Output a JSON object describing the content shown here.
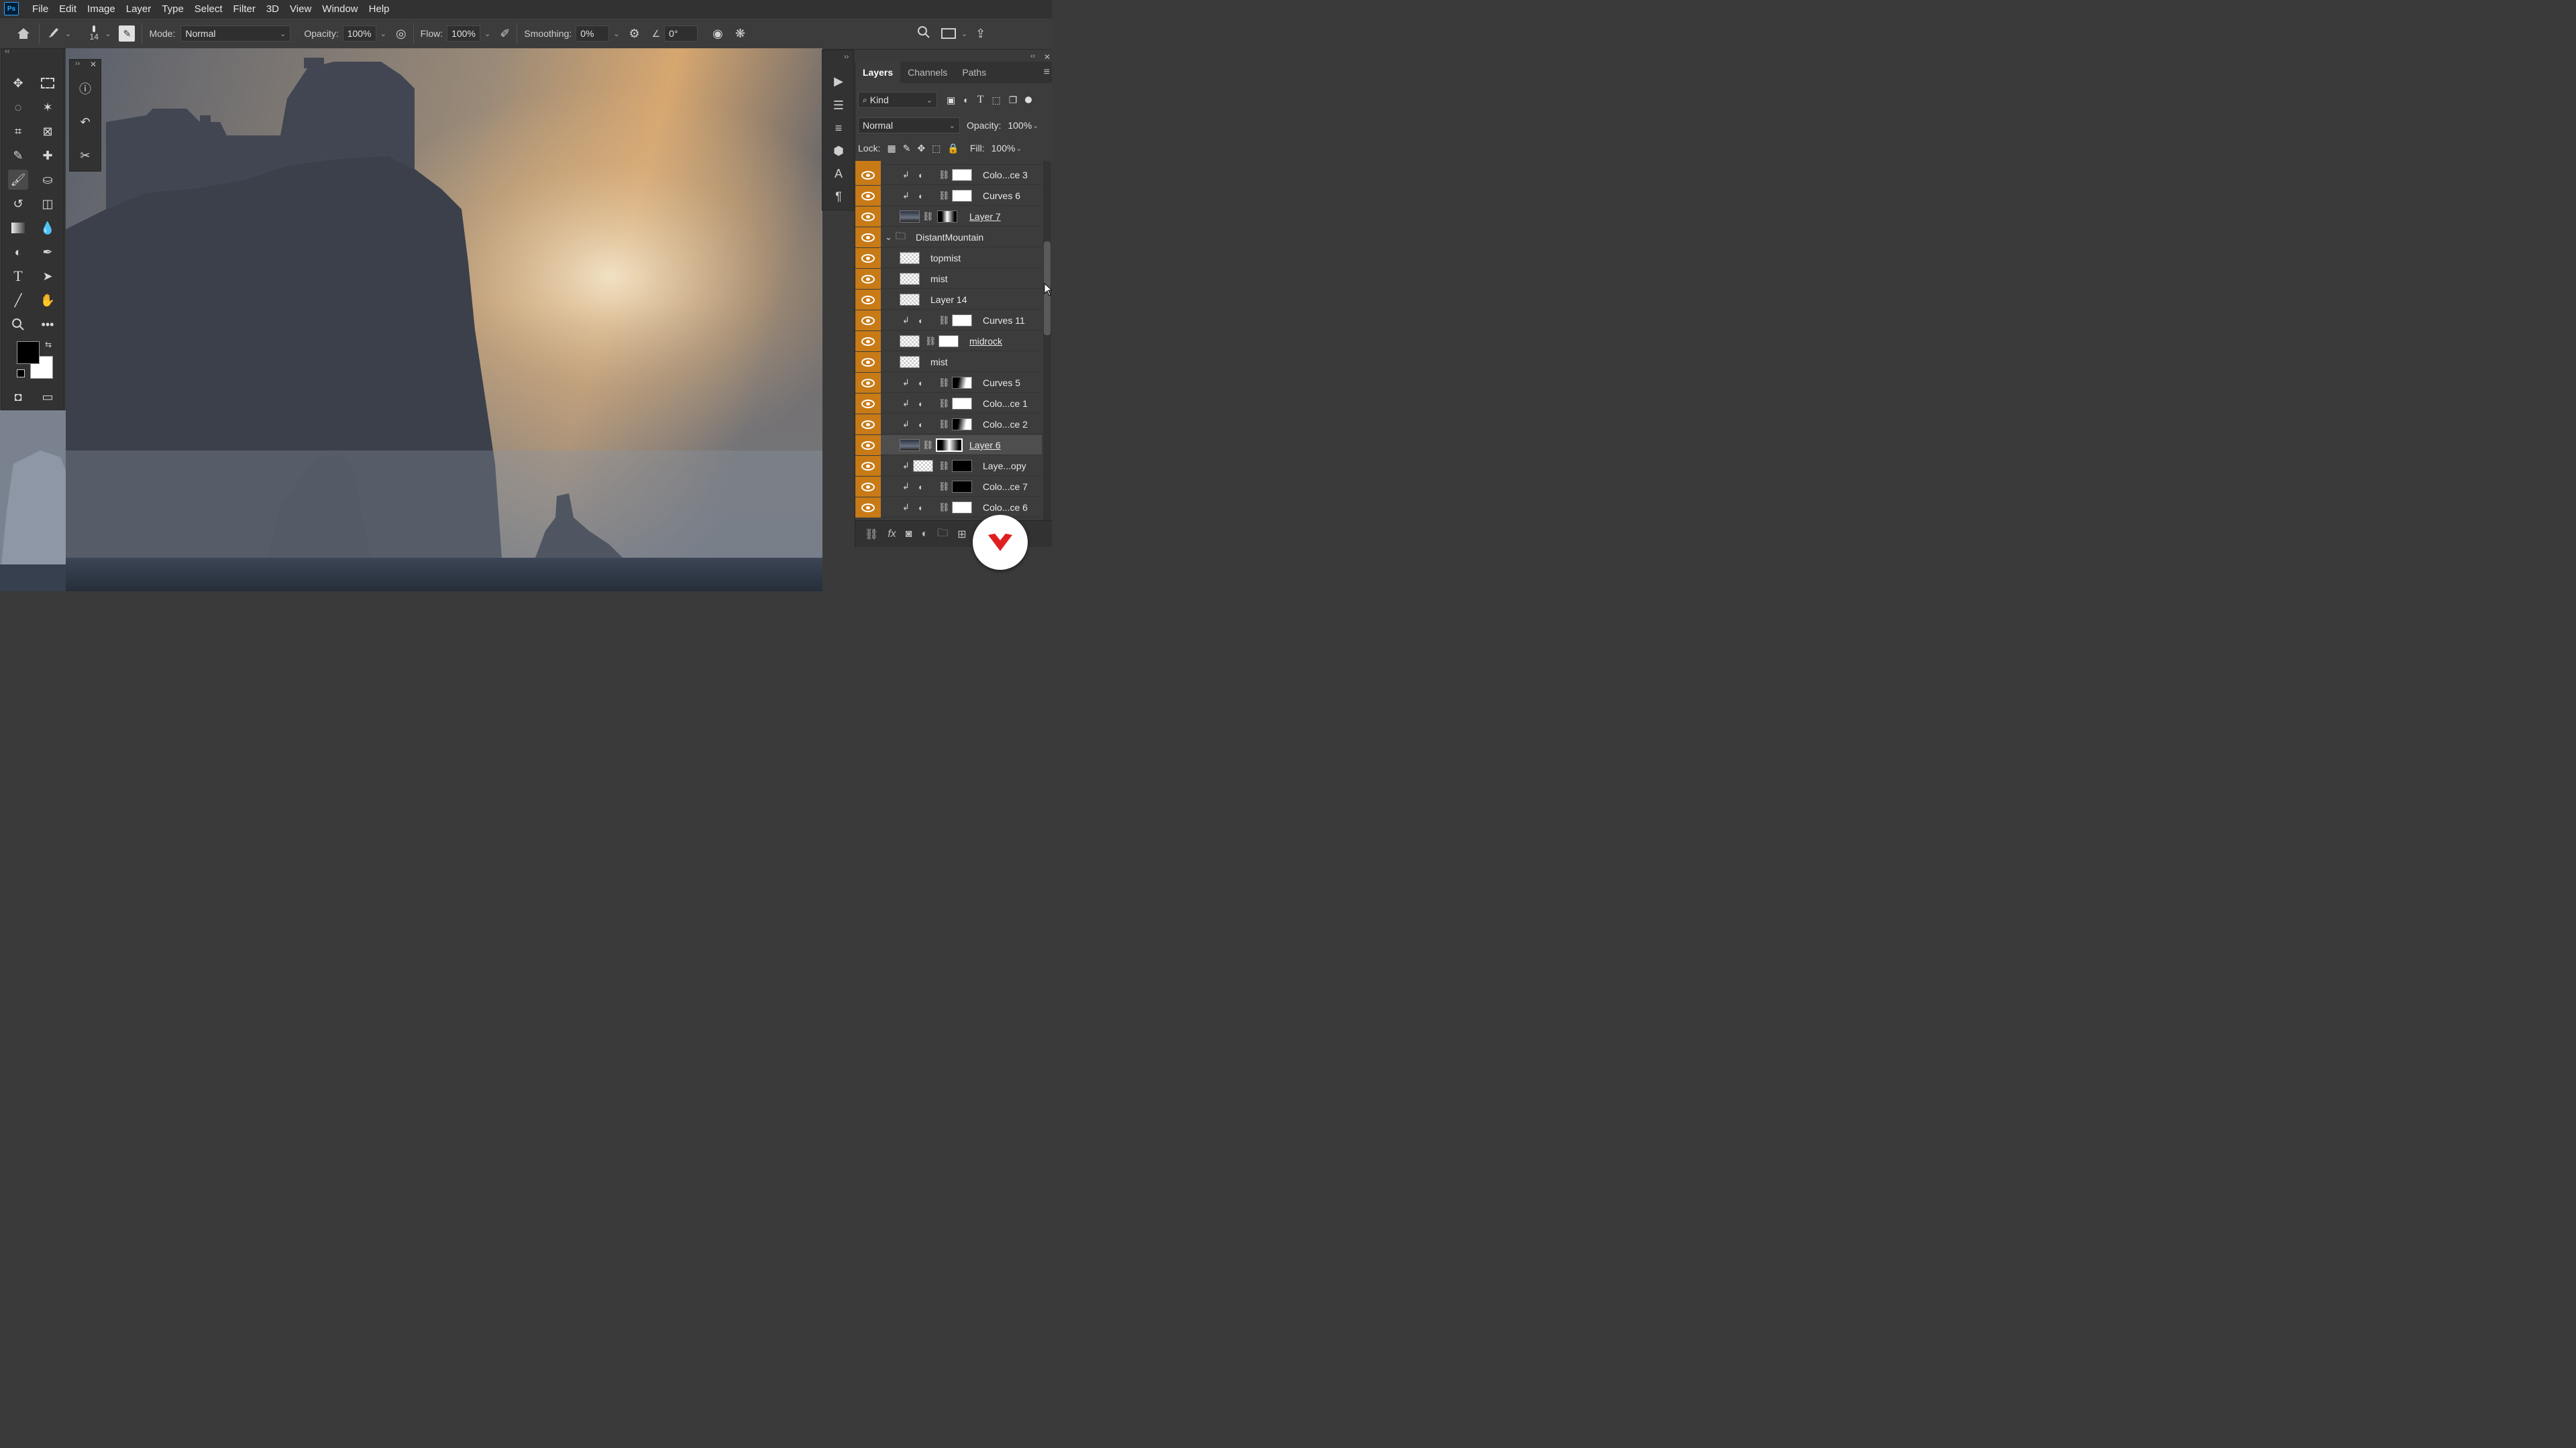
{
  "menubar": {
    "logo": "Ps",
    "items": [
      "File",
      "Edit",
      "Image",
      "Layer",
      "Type",
      "Select",
      "Filter",
      "3D",
      "View",
      "Window",
      "Help"
    ]
  },
  "options": {
    "brush_size": "14",
    "mode_label": "Mode:",
    "mode_value": "Normal",
    "opacity_label": "Opacity:",
    "opacity_value": "100%",
    "flow_label": "Flow:",
    "flow_value": "100%",
    "smoothing_label": "Smoothing:",
    "smoothing_value": "0%",
    "angle_value": "0°"
  },
  "colors": {
    "foreground": "#000000",
    "background": "#ffffff",
    "accent_eye": "#c77a16"
  },
  "layers_panel": {
    "tabs": [
      "Layers",
      "Channels",
      "Paths"
    ],
    "filter_kind": "Kind",
    "blend_mode": "Normal",
    "opacity_label": "Opacity:",
    "opacity_value": "100%",
    "lock_label": "Lock:",
    "fill_label": "Fill:",
    "fill_value": "100%",
    "layers": [
      {
        "name": "Colo...ce 3",
        "type": "adjustment",
        "clipped": true,
        "mask": "white"
      },
      {
        "name": "Curves 6",
        "type": "adjustment",
        "clipped": true,
        "mask": "white"
      },
      {
        "name": "Layer 7",
        "type": "image",
        "clipped": false,
        "mask": "mixed2",
        "underlined": true
      },
      {
        "name": "DistantMountain",
        "type": "group"
      },
      {
        "name": "topmist",
        "type": "pixel"
      },
      {
        "name": "mist",
        "type": "pixel"
      },
      {
        "name": "Layer 14",
        "type": "pixel"
      },
      {
        "name": "Curves 11",
        "type": "adjustment",
        "clipped": true,
        "mask": "white"
      },
      {
        "name": "midrock",
        "type": "pixel-mask",
        "mask": "white",
        "underlined": true
      },
      {
        "name": "mist",
        "type": "pixel"
      },
      {
        "name": "Curves 5",
        "type": "adjustment",
        "clipped": true,
        "mask": "mixed"
      },
      {
        "name": "Colo...ce 1",
        "type": "adjustment",
        "clipped": true,
        "mask": "white"
      },
      {
        "name": "Colo...ce 2",
        "type": "adjustment",
        "clipped": true,
        "mask": "mixed"
      },
      {
        "name": "Layer 6",
        "type": "image",
        "mask": "mixed2",
        "underlined": true,
        "selected": true
      },
      {
        "name": "Laye...opy",
        "type": "pixel-mask-clipped",
        "clipped": true,
        "mask": "black"
      },
      {
        "name": "Colo...ce 7",
        "type": "adjustment",
        "clipped": true,
        "mask": "black"
      },
      {
        "name": "Colo...ce 6",
        "type": "adjustment",
        "clipped": true,
        "mask": "white"
      }
    ]
  }
}
